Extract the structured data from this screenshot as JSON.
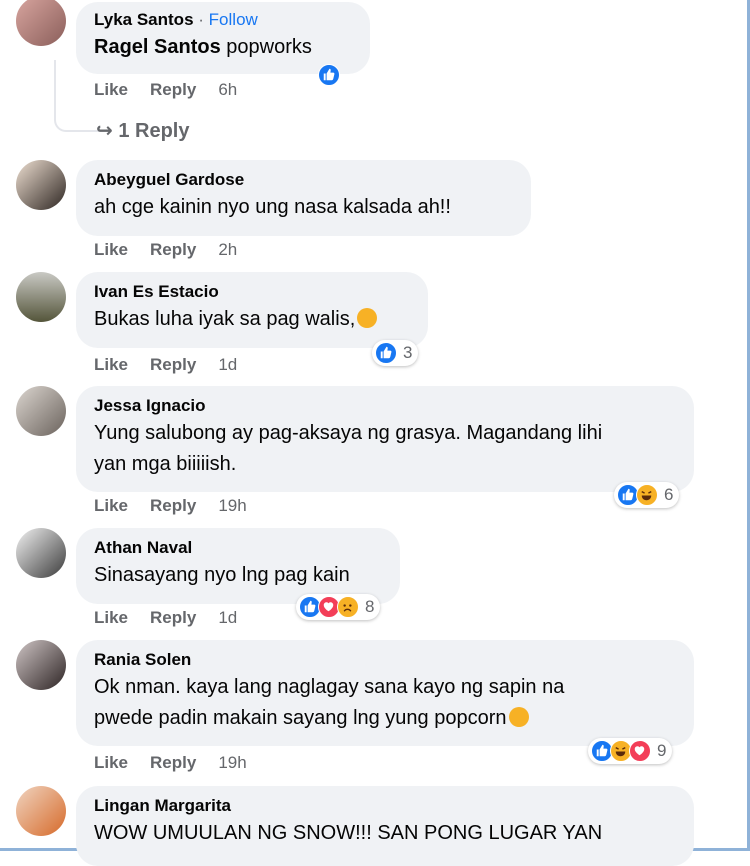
{
  "comments": [
    {
      "author": "Lyka Santos",
      "follow": "Follow",
      "mention": "Ragel Santos",
      "text": "popworks",
      "time": "6h",
      "replies": "1 Reply"
    },
    {
      "author": "Abeyguel Gardose",
      "text": "ah cge kainin nyo ung nasa kalsada ah!!",
      "time": "2h"
    },
    {
      "author": "Ivan Es Estacio",
      "text": "Bukas luha iyak sa pag walis,",
      "time": "1d",
      "react_count": "3"
    },
    {
      "author": "Jessa Ignacio",
      "text_line1": "Yung salubong ay pag-aksaya ng grasya. Magandang lihi",
      "text_line2": "yan mga biiiiish.",
      "time": "19h",
      "react_count": "6"
    },
    {
      "author": "Athan Naval",
      "text": "Sinasayang nyo lng pag kain",
      "time": "1d",
      "react_count": "8"
    },
    {
      "author": "Rania Solen",
      "text_line1": "Ok nman. kaya lang naglagay sana kayo ng sapin na",
      "text_line2": "pwede padin makain sayang lng yung popcorn",
      "time": "19h",
      "react_count": "9"
    },
    {
      "author": "Lingan Margarita",
      "text": "WOW UMUULAN NG SNOW!!! SAN PONG LUGAR YAN"
    }
  ],
  "actions": {
    "like": "Like",
    "reply": "Reply"
  },
  "colors": {
    "bubble": "#f0f2f5",
    "link_blue": "#1877f2",
    "secondary": "#65676b",
    "like": "#1877f2",
    "love": "#f33e58",
    "haha": "#f7b125"
  }
}
